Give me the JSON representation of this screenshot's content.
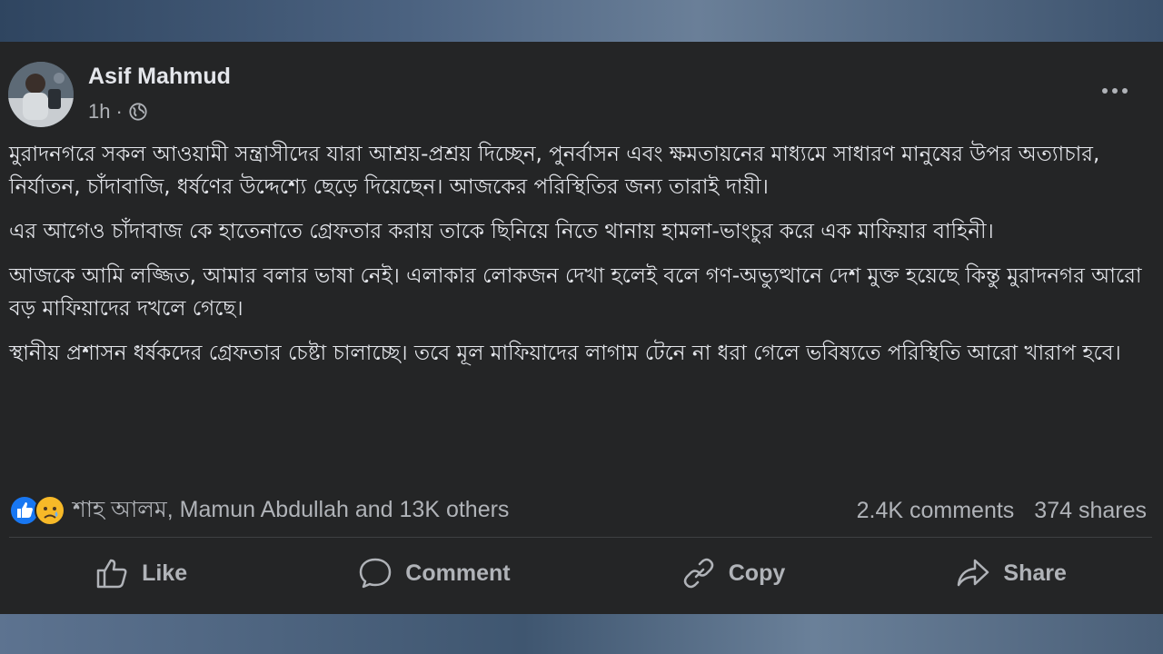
{
  "post": {
    "author": "Asif Mahmud",
    "time": "1h",
    "paragraphs": [
      "মুরাদনগরে সকল আওয়ামী সন্ত্রাসীদের যারা আশ্রয়-প্রশ্রয় দিচ্ছেন, পুনর্বাসন এবং ক্ষমতায়নের মাধ্যমে সাধারণ মানুষের উপর অত্যাচার, নির্যাতন, চাঁদাবাজি, ধর্ষণের উদ্দেশ্যে ছেড়ে দিয়েছেন। আজকের পরিস্থিতির জন্য তারাই দায়ী।",
      "এর আগেও চাঁদাবাজ কে হাতেনাতে গ্রেফতার করায় তাকে ছিনিয়ে নিতে থানায় হামলা-ভাংচুর করে এক মাফিয়ার বাহিনী।",
      "আজকে আমি লজ্জিত, আমার বলার ভাষা নেই। এলাকার লোকজন দেখা হলেই বলে গণ-অভ্যুত্থানে দেশ মুক্ত হয়েছে কিন্তু মুরাদনগর আরো বড় মাফিয়াদের দখলে গেছে।",
      "স্থানীয় প্রশাসন ধর্ষকদের গ্রেফতার চেষ্টা চালাচ্ছে। তবে মূল মাফিয়াদের লাগাম টেনে না ধরা গেলে ভবিষ্যতে পরিস্থিতি আরো খারাপ হবে।"
    ]
  },
  "reactions": {
    "icons": [
      "like-icon",
      "sad-icon"
    ],
    "summary": "শাহ আলম, Mamun Abdullah and 13K others",
    "comments": "2.4K comments",
    "shares": "374 shares"
  },
  "actions": {
    "like": "Like",
    "comment": "Comment",
    "copy": "Copy",
    "share": "Share"
  },
  "colors": {
    "card_bg": "#242526",
    "text": "#e4e6eb",
    "muted": "#b0b3b8",
    "like_blue": "#1877f2",
    "sad_yellow": "#f7b928"
  }
}
